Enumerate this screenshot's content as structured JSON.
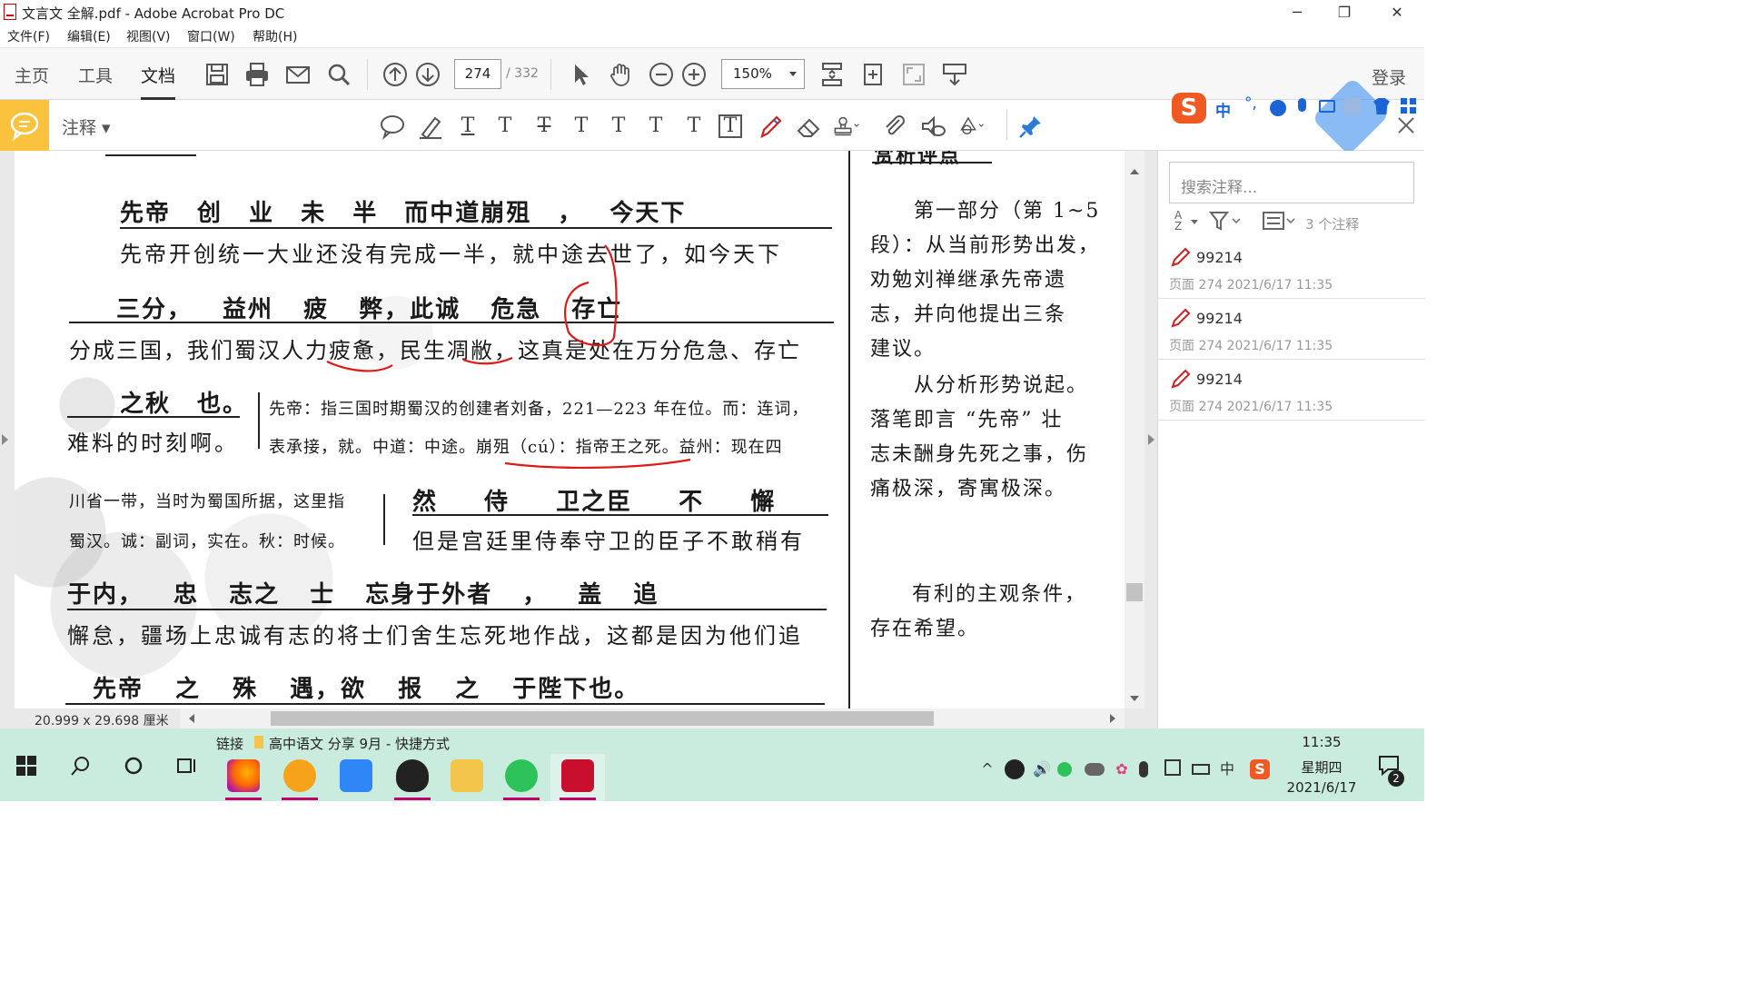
{
  "window": {
    "title": "文言文 全解.pdf - Adobe Acrobat Pro DC",
    "minimize": "─",
    "restore": "❐",
    "close": "✕"
  },
  "menu": [
    "文件(F)",
    "编辑(E)",
    "视图(V)",
    "窗口(W)",
    "帮助(H)"
  ],
  "toolbar": {
    "tabs": [
      "主页",
      "工具",
      "文档"
    ],
    "page_current": "274",
    "page_total": "/ 332",
    "zoom": "150%",
    "login": "登录"
  },
  "comment_toolbar": {
    "label": "注释 ▾"
  },
  "document": {
    "orig_lines": [
      "先帝 创 业 未 半 而中道崩殂 ， 今天下",
      "三分， 益州 疲 弊，此诚 危急 存亡",
      "之秋 也。",
      "然 侍 卫之臣 不 懈",
      "于内， 忠 志之 士 忘身于外者 ， 盖 追",
      "先帝 之 殊 遇，欲 报 之 于陛下也。"
    ],
    "trans_lines": [
      "先帝开创统一大业还没有完成一半，就中途去世了，如今天下",
      "分成三国，我们蜀汉人力疲惫，民生凋敝，这真是处在万分危急、存亡",
      "难料的时刻啊。",
      "但是宫廷里侍奉守卫的臣子不敢稍有",
      "懈怠，疆场上忠诚有志的将士们舍生忘死地作战，这都是因为他们追"
    ],
    "note_lines": [
      "先帝：指三国时期蜀汉的创建者刘备，221—223 年在位。而：连词，",
      "表承接，就。中道：中途。崩殂（cú）：指帝王之死。益州：现在四",
      "川省一带，当时为蜀国所据，这里指",
      "蜀汉。诚：副词，实在。秋：时候。"
    ],
    "side_heading": "赏析评点",
    "side_lines": [
      "第一部分（第 1~5",
      "段）：从当前形势出发，",
      "劝勉刘禅继承先帝遗",
      "志，并向他提出三条",
      "建议。",
      "从分析形势说起。",
      "落笔即言 “先帝” 壮",
      "志未酬身先死之事，伤",
      "痛极深，寄寓极深。",
      "有利的主观条件，",
      "存在希望。"
    ],
    "page_size": "20.999 x 29.698 厘米"
  },
  "comments_panel": {
    "search_placeholder": "搜索注释...",
    "count": "3 个注释",
    "items": [
      {
        "author": "99214",
        "meta": "页面 274  2021/6/17  11:35"
      },
      {
        "author": "99214",
        "meta": "页面 274  2021/6/17  11:35"
      },
      {
        "author": "99214",
        "meta": "页面 274  2021/6/17  11:35"
      }
    ]
  },
  "taskbar": {
    "link": "链接",
    "folder": "高中语文 分享 9月 - 快捷方式",
    "time": "11:35",
    "weekday": "星期四",
    "date": "2021/6/17",
    "notif_count": "2",
    "ime": "中"
  },
  "ime_toolbar": {
    "lang": "中"
  },
  "colors": {
    "accent_yellow": "#fbc33d",
    "ink_red": "#e01818",
    "taskbar": "#c9ecdf",
    "sogou": "#f05a22"
  }
}
